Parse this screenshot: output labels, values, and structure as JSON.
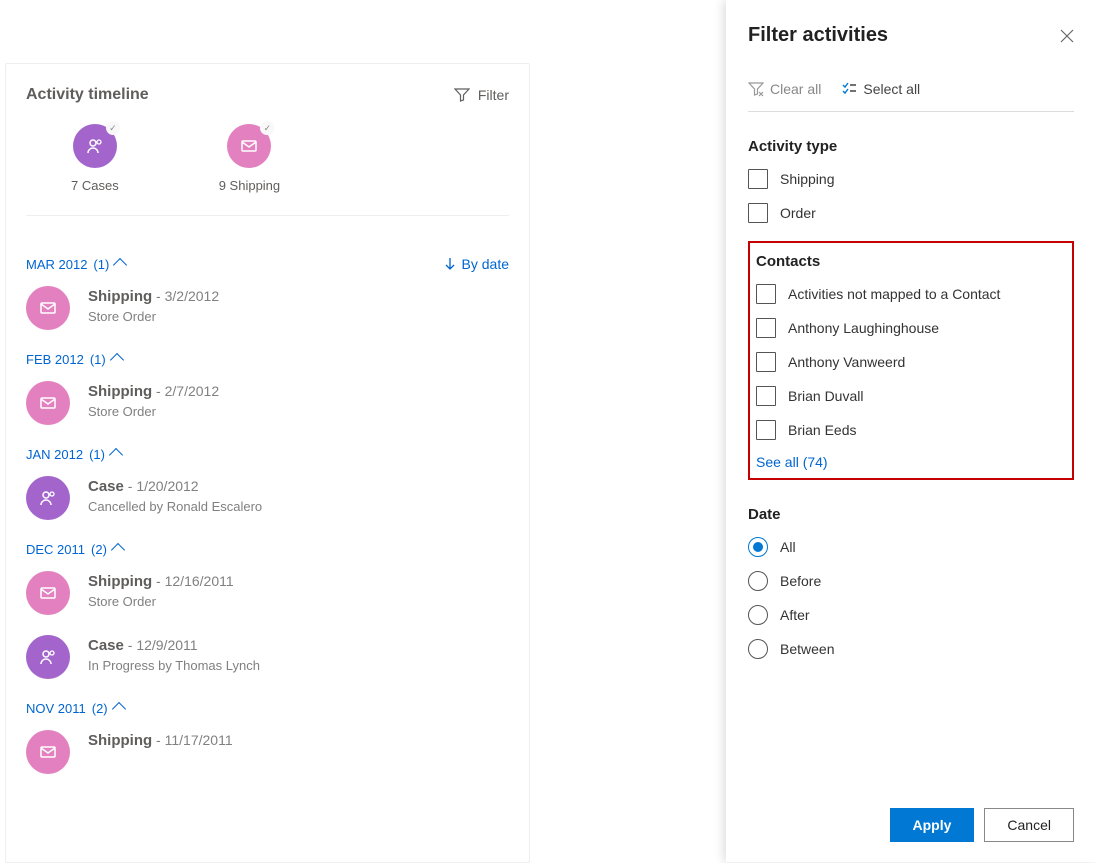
{
  "card": {
    "title": "Activity timeline",
    "filter_label": "Filter",
    "stats": {
      "cases": "7 Cases",
      "shipping": "9 Shipping"
    },
    "by_date": "By date"
  },
  "groups": [
    {
      "label": "MAR 2012",
      "count": "(1)"
    },
    {
      "label": "FEB 2012",
      "count": "(1)"
    },
    {
      "label": "JAN 2012",
      "count": "(1)"
    },
    {
      "label": "DEC 2011",
      "count": "(2)"
    },
    {
      "label": "NOV 2011",
      "count": "(2)"
    }
  ],
  "items": {
    "mar": {
      "title": "Shipping",
      "date": "3/2/2012",
      "sub": "Store Order"
    },
    "feb": {
      "title": "Shipping",
      "date": "2/7/2012",
      "sub": "Store Order"
    },
    "jan": {
      "title": "Case",
      "date": "1/20/2012",
      "sub": "Cancelled by Ronald Escalero"
    },
    "dec1": {
      "title": "Shipping",
      "date": "12/16/2011",
      "sub": "Store Order"
    },
    "dec2": {
      "title": "Case",
      "date": "12/9/2011",
      "sub": "In Progress by Thomas Lynch"
    },
    "nov": {
      "title": "Shipping",
      "date": "11/17/2011"
    }
  },
  "panel": {
    "title": "Filter activities",
    "clear_all": "Clear all",
    "select_all": "Select all",
    "activity_type_header": "Activity type",
    "activity_types": [
      "Shipping",
      "Order"
    ],
    "contacts_header": "Contacts",
    "contacts": [
      "Activities not mapped to a Contact",
      "Anthony Laughinghouse",
      "Anthony Vanweerd",
      "Brian Duvall",
      "Brian Eeds"
    ],
    "see_all": "See all (74)",
    "date_header": "Date",
    "date_options": [
      "All",
      "Before",
      "After",
      "Between"
    ],
    "apply": "Apply",
    "cancel": "Cancel"
  }
}
